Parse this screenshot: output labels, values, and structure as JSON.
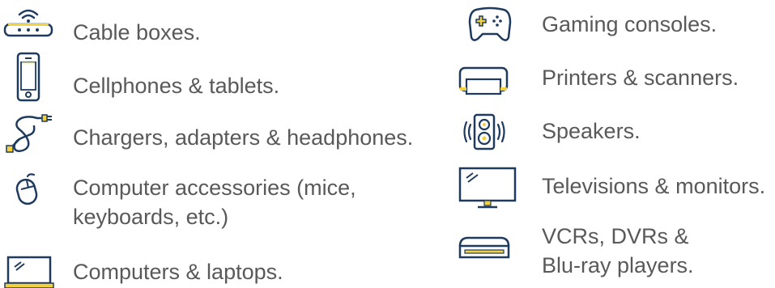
{
  "colors": {
    "navy": "#1f3a5f",
    "yellow": "#f2d13c",
    "text": "#595959"
  },
  "left_column": [
    {
      "icon": "cable-box-icon",
      "label": "Cable boxes."
    },
    {
      "icon": "cellphone-icon",
      "label": "Cellphones & tablets."
    },
    {
      "icon": "charger-cable-icon",
      "label": "Chargers, adapters & headphones."
    },
    {
      "icon": "computer-mouse-icon",
      "label": "Computer accessories (mice,\nkeyboards, etc.)"
    },
    {
      "icon": "laptop-icon",
      "label": "Computers & laptops."
    }
  ],
  "right_column": [
    {
      "icon": "gamepad-icon",
      "label": "Gaming consoles."
    },
    {
      "icon": "printer-icon",
      "label": "Printers & scanners."
    },
    {
      "icon": "speaker-icon",
      "label": "Speakers."
    },
    {
      "icon": "television-icon",
      "label": "Televisions & monitors."
    },
    {
      "icon": "vcr-dvr-player-icon",
      "label": "VCRs, DVRs &\nBlu-ray players."
    }
  ]
}
